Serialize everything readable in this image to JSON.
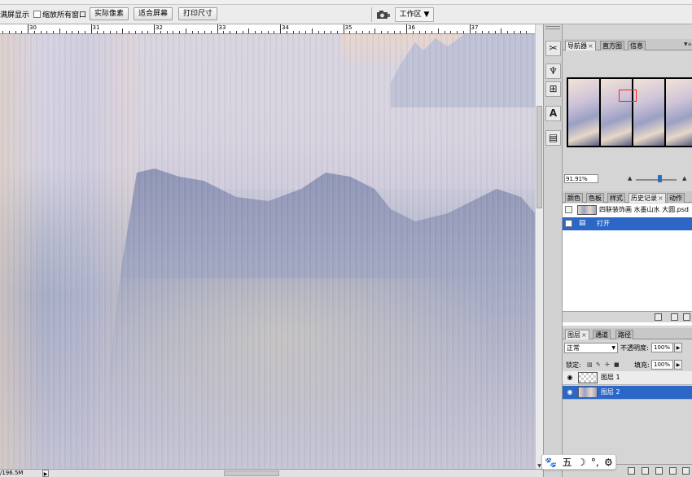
{
  "options_bar": {
    "fullscreen_label": "满屏显示",
    "zoom_all_label": "缩放所有窗口",
    "actual_pixels_label": "实际像素",
    "fit_screen_label": "适合屏幕",
    "print_size_label": "打印尺寸",
    "workspace_label": "工作区"
  },
  "ruler": {
    "labels": [
      "30",
      "31",
      "32",
      "33",
      "34",
      "35",
      "36",
      "37"
    ]
  },
  "status_bar": {
    "doc_size": "/196.5M",
    "arrow_glyph": "▶"
  },
  "tools": {
    "items": [
      "tools-icon",
      "clone-source-icon",
      "brush-presets-icon",
      "character-icon",
      "notes-icon"
    ]
  },
  "navigator_panel": {
    "tabs": [
      "导航器",
      "直方图",
      "信息"
    ],
    "active_tab": "导航器",
    "zoom_value": "91.91%",
    "thumbnail_panels": 4
  },
  "history_panel": {
    "tabs": [
      "颜色",
      "色板",
      "样式",
      "历史记录",
      "动作"
    ],
    "active_tab": "历史记录",
    "snapshot_name": "四联装饰画 水墨山水 大圆.psd",
    "states": [
      "打开"
    ],
    "selected_state": "打开"
  },
  "layers_panel": {
    "tabs": [
      "图层",
      "通道",
      "路径"
    ],
    "active_tab": "图层",
    "blend_mode": "正常",
    "opacity_label": "不透明度:",
    "opacity_value": "100%",
    "lock_label": "锁定:",
    "fill_label": "填充:",
    "fill_value": "100%",
    "layers": [
      {
        "name": "图层 1",
        "visible": true,
        "selected": false
      },
      {
        "name": "图层 2",
        "visible": true,
        "selected": true
      }
    ]
  },
  "ime_bar": {
    "mode_label": "五"
  },
  "colors": {
    "selection_blue": "#2c67c7",
    "panel_gray": "#d6d6d6",
    "nav_highlight_red": "#ff2020"
  }
}
